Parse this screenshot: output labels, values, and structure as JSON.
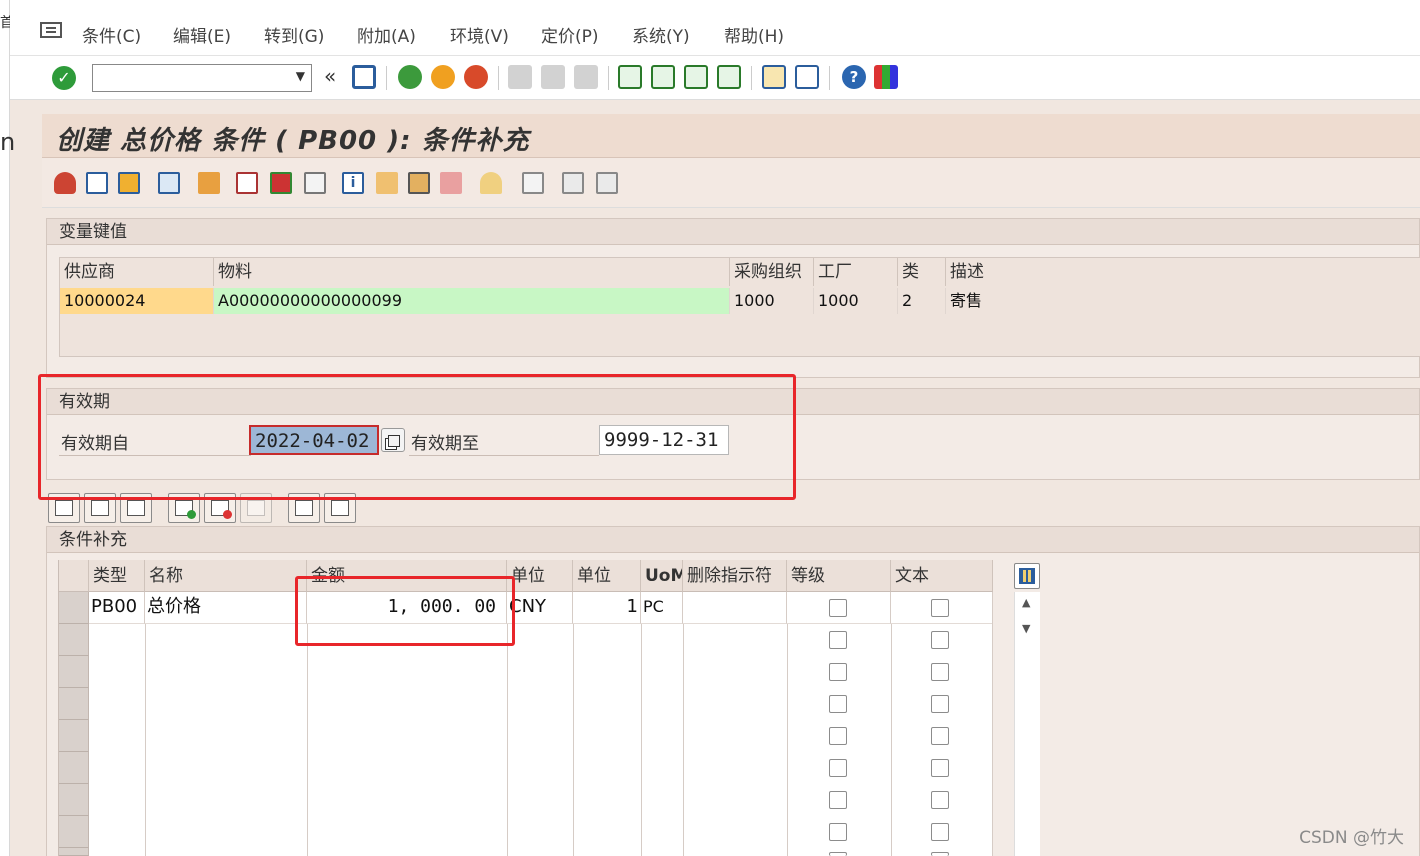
{
  "left_strip": {
    "char_top": "首",
    "char_mid": "n"
  },
  "menu": {
    "items": [
      "条件(C)",
      "编辑(E)",
      "转到(G)",
      "附加(A)",
      "环境(V)",
      "定价(P)",
      "系统(Y)",
      "帮助(H)"
    ]
  },
  "toolbar": {
    "command_field": ""
  },
  "title": "创建 总价格 条件 ( PB00 ): 条件补充",
  "key_panel": {
    "heading": "变量键值",
    "columns": [
      "供应商",
      "物料",
      "采购组织",
      "工厂",
      "类",
      "描述"
    ],
    "row": [
      "10000024",
      "A00000000000000099",
      "1000",
      "1000",
      "2",
      "寄售"
    ]
  },
  "validity": {
    "heading": "有效期",
    "from_label": "有效期自",
    "from_value": "2022-04-02",
    "to_label": "有效期至",
    "to_value": "9999-12-31"
  },
  "supplement": {
    "heading": "条件补充",
    "columns": [
      "类型",
      "名称",
      "金额",
      "单位",
      "单位",
      "UoM",
      "删除指示符",
      "等级",
      "文本"
    ],
    "rows": [
      {
        "type": "PB00",
        "name": "总价格",
        "amount": "1, 000. 00",
        "unit": "CNY",
        "per": "1",
        "uom": "PC"
      }
    ]
  },
  "watermark": "CSDN @竹大",
  "colors": {
    "accent_red": "#e8262a",
    "vendor_bg": "#ffd98c",
    "material_bg": "#c8f7c5",
    "ok_green": "#2e9b3a"
  }
}
